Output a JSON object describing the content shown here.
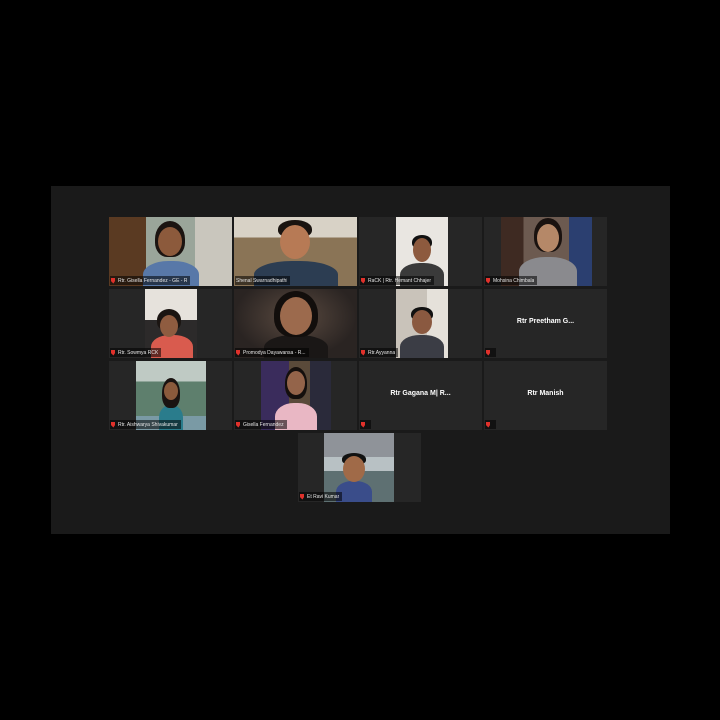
{
  "participants": [
    {
      "name": "Rtr. Gisella Fernandez - GE - R",
      "muted": true,
      "video": true
    },
    {
      "name": "Shenal Swarnadhipathi",
      "muted": false,
      "video": true,
      "active_speaker": true
    },
    {
      "name": "RaCK | Rtr. Hemant Chhajer",
      "muted": true,
      "video": true
    },
    {
      "name": "Mohsina Chimbala",
      "muted": true,
      "video": true
    },
    {
      "name": "Rtr. Sowmya RCK",
      "muted": true,
      "video": true
    },
    {
      "name": "Promodya Dayawansa - R...",
      "muted": true,
      "video": true
    },
    {
      "name": "Rtr.Ayyanna",
      "muted": true,
      "video": true
    },
    {
      "name": "Rtr Preetham G...",
      "muted": true,
      "video": false
    },
    {
      "name": "Rtr. Aishwarya Shivakumar",
      "muted": true,
      "video": true
    },
    {
      "name": "Gisella Fernandez",
      "muted": true,
      "video": true
    },
    {
      "name": "Rtr Gagana M| R...",
      "muted": true,
      "video": false
    },
    {
      "name": "Rtr Manish",
      "muted": true,
      "video": false
    },
    {
      "name": "Et Ravi Kumar",
      "muted": true,
      "video": true
    }
  ],
  "colors": {
    "active_speaker_border": "#9ec73f",
    "muted_icon": "#e0312b",
    "tile_background": "#262626"
  }
}
